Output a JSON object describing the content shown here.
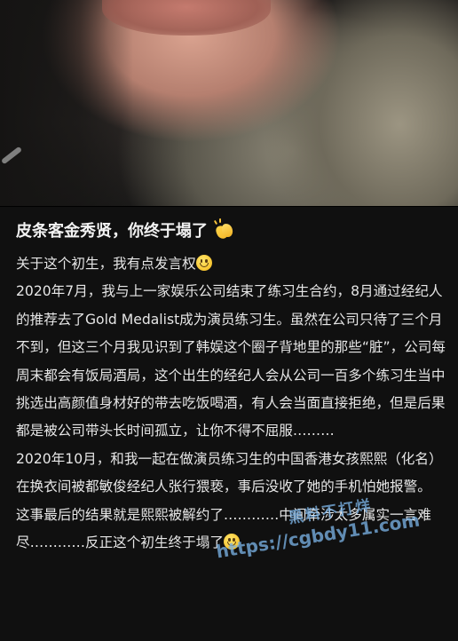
{
  "photo": {
    "alt": ""
  },
  "post": {
    "title": "皮条客金秀贤，你终于塌了",
    "title_emoji": "clapping-hands",
    "paragraphs": [
      {
        "text": "关于这个初生，我有点发言权",
        "trailing_emoji": "smile"
      },
      {
        "text": "2020年7月，我与上一家娱乐公司结束了练习生合约，8月通过经纪人的推荐去了Gold Medalist成为演员练习生。虽然在公司只待了三个月不到，但这三个月我见识到了韩娱这个圈子背地里的那些“脏”，公司每周末都会有饭局酒局，这个出生的经纪人会从公司一百多个练习生当中挑选出高颜值身材好的带去吃饭喝酒，有人会当面直接拒绝，但是后果都是被公司带头长时间孤立，让你不得不屈服………"
      },
      {
        "text": "2020年10月，和我一起在做演员练习生的中国香港女孩熙熙（化名）在换衣间被都敏俊经纪人张行猥亵，事后没收了她的手机怕她报警。"
      },
      {
        "text": "这事最后的结果就是熙熙被解约了…………中间牵涉太多属实一言难尽…………反正这个初生终于塌了",
        "trailing_emoji": "smile"
      }
    ]
  },
  "watermark": {
    "name": "黑料不打烊",
    "url": "https://cgbdy11.com"
  }
}
